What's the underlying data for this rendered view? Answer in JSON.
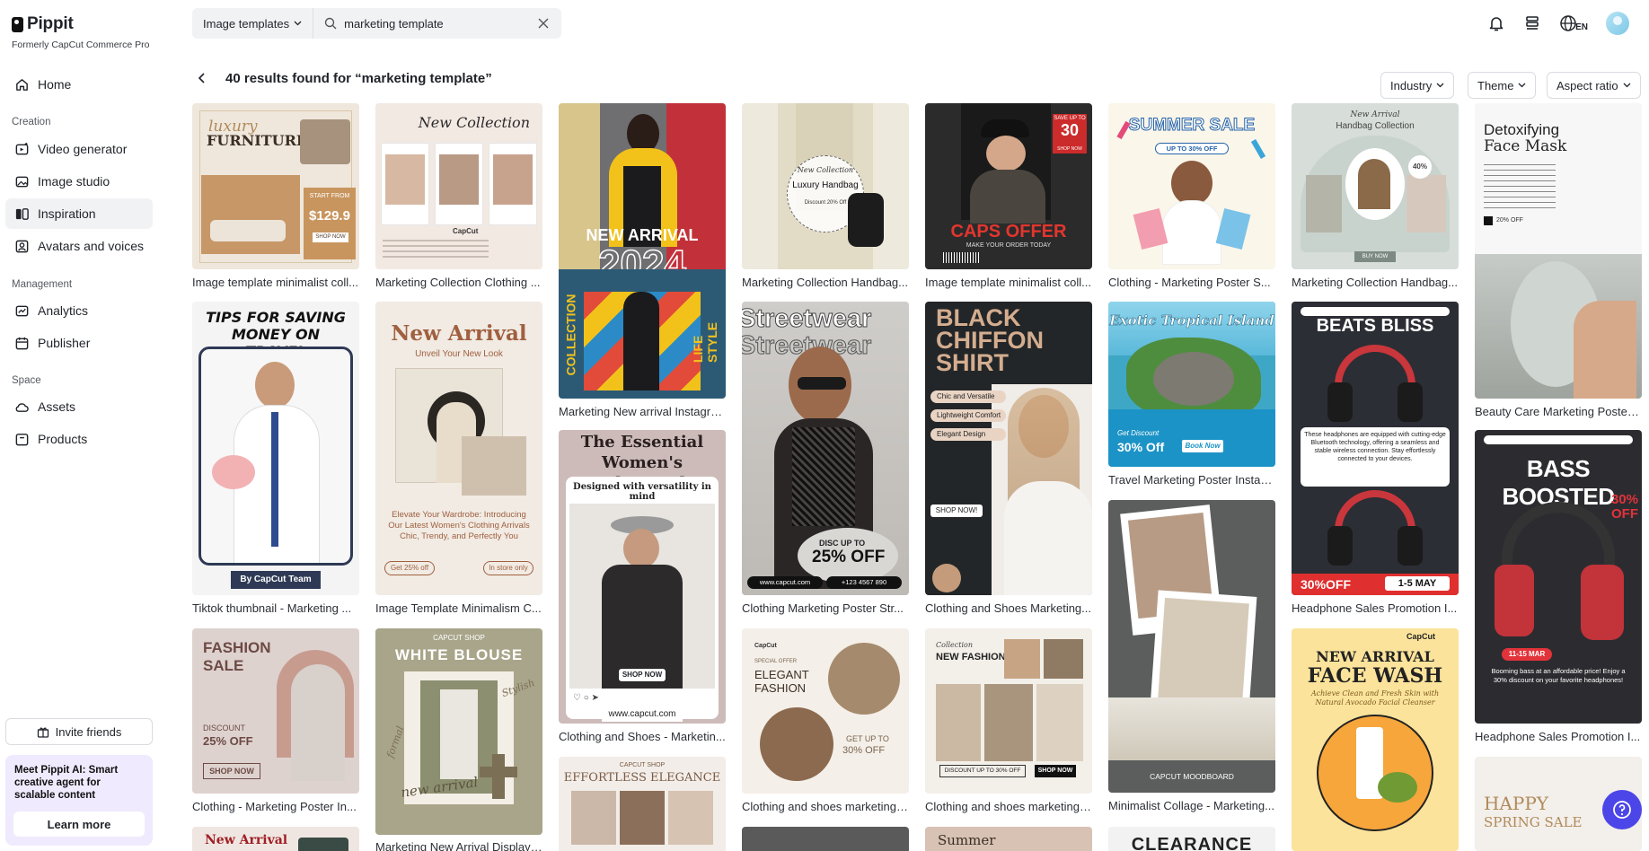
{
  "brand": {
    "name": "Pippit",
    "subtitle": "Formerly CapCut Commerce Pro"
  },
  "nav": {
    "home": "Home",
    "creation_label": "Creation",
    "video_generator": "Video generator",
    "image_studio": "Image studio",
    "inspiration": "Inspiration",
    "avatars": "Avatars and voices",
    "management_label": "Management",
    "analytics": "Analytics",
    "publisher": "Publisher",
    "space_label": "Space",
    "assets": "Assets",
    "products": "Products"
  },
  "invite": {
    "label": "Invite friends"
  },
  "promo": {
    "text": "Meet Pippit AI: Smart creative agent for scalable content",
    "button": "Learn more"
  },
  "search": {
    "type": "Image templates",
    "value": "marketing template"
  },
  "header": {
    "lang": "EN"
  },
  "results": {
    "title": "40 results found for “marketing template”"
  },
  "filters": {
    "industry": "Industry",
    "theme": "Theme",
    "aspect": "Aspect ratio"
  },
  "cards": {
    "c1": {
      "caption": "Image template minimalist coll...",
      "t1": "luxury",
      "t2": "FURNITURE",
      "t3": "START FROM",
      "t4": "$129.9",
      "t5": "SHOP NOW"
    },
    "c2": {
      "caption": "Marketing Collection Clothing ...",
      "t1": "New Collection",
      "t2": "CapCut"
    },
    "c3": {
      "caption": "Marketing New arrival Instagra...",
      "t1": "NEW ARRIVAL",
      "t2": "2024",
      "t3": "COLLECTION",
      "t4": "LIFE STYLE"
    },
    "c4": {
      "caption": "Marketing Collection Handbag...",
      "t1": "New Collection",
      "t2": "Luxury Handbag",
      "t3": "Discount 20% Off"
    },
    "c5": {
      "caption": "Image template minimalist coll...",
      "t1": "CAPS OFFER",
      "t2": "MAKE YOUR ORDER TODAY",
      "t3": "SAVE UP TO",
      "t4": "30",
      "t5": "SHOP NOW"
    },
    "c6": {
      "caption": "Clothing - Marketing Poster S...",
      "t1": "SUMMER SALE",
      "t2": "UP TO 30% OFF"
    },
    "c7": {
      "caption": "Marketing Collection Handbag...",
      "t1": "New Arrival",
      "t2": "Handbag Collection",
      "t3": "40%",
      "t4": "BUY NOW"
    },
    "c8": {
      "caption": "Beauty Care Marketing Poster ...",
      "t1": "Detoxifying",
      "t2": "Face Mask",
      "t3": "20% OFF"
    },
    "c9": {
      "caption": "Tiktok thumbnail - Marketing ...",
      "t1": "TIPS FOR SAVING MONEY ON TRAVEL",
      "t2": "By CapCut Team"
    },
    "c10": {
      "caption": "Image Template Minimalism C...",
      "t1": "New Arrival",
      "t2": "Unveil Your New Look",
      "t3": "Elevate Your Wardrobe: Introducing Our Latest Women's Clothing Arrivals Chic, Trendy, and Perfectly You",
      "t4": "Get 25% off",
      "t5": "In store only"
    },
    "c11": {
      "caption": "Clothing and Shoes - Marketin...",
      "t1": "The Essential Women's Leather Jacket",
      "t2": "Designed with versatility in mind",
      "t3": "SHOP NOW",
      "t4": "www.capcut.com"
    },
    "c12": {
      "caption": "Clothing Marketing Poster Str...",
      "t1": "Streetwear",
      "t2": "DISC UP TO",
      "t3": "25% OFF",
      "t4": "www.capcut.com",
      "t5": "+123 4567 890"
    },
    "c13": {
      "caption": "Clothing and Shoes Marketing...",
      "t1": "BLACK CHIFFON SHIRT",
      "t2": "Chic and Versatile",
      "t3": "Lightweight Comfort",
      "t4": "Elegant Design",
      "t5": "SHOP NOW!"
    },
    "c14": {
      "caption": "Travel Marketing Poster Instag...",
      "t1": "Exotic Tropical Island",
      "t2": "Get Discount",
      "t3": "30% Off",
      "t4": "Book Now"
    },
    "c15": {
      "caption": "Headphone Sales Promotion I...",
      "t1": "BEATS BLISS",
      "t2": "30%OFF",
      "t3": "1-5 MAY",
      "t4": "These headphones are equipped with cutting-edge Bluetooth technology, offering a seamless and stable wireless connection. Stay effortlessly connected to your devices."
    },
    "c16": {
      "caption": "Headphone Sales Promotion I...",
      "t1": "BASS BOOSTED",
      "t2": "30% OFF",
      "t3": "11-15 MAR",
      "t4": "Booming bass at an affordable price! Enjoy a 30% discount on your favorite headphones!"
    },
    "c17": {
      "caption": "Clothing - Marketing Poster In...",
      "t1": "FASHION SALE",
      "t2": "DISCOUNT",
      "t3": "25% OFF",
      "t4": "SHOP NOW"
    },
    "c18": {
      "caption": "Marketing New Arrival Display ...",
      "t1": "CAPCUT SHOP",
      "t2": "WHITE BLOUSE",
      "t3": "new arrival",
      "t4": "Stylish",
      "t5": "formal"
    },
    "c19": {
      "caption": "Clothing and shoes marketing ...",
      "t1": "ELEGANT FASHION",
      "t2": "SPECIAL OFFER",
      "t3": "GET UP TO",
      "t4": "30% OFF",
      "t5": "CapCut"
    },
    "c20": {
      "caption": "Clothing and shoes marketing ...",
      "t1": "NEW FASHION",
      "t2": "DISCOUNT UP TO 30% OFF",
      "t3": "SHOP NOW",
      "t4": "Collection"
    },
    "c21": {
      "caption": "Minimalist Collage - Marketing...",
      "t1": "CAPCUT MOODBOARD"
    },
    "c22": {
      "caption": "",
      "t1": "NEW ARRIVAL",
      "t2": "FACE WASH",
      "t3": "Achieve Clean and Fresh Skin with Natural Avocado Facial Cleanser",
      "t4": "CapCut"
    },
    "c23": {
      "t1": "CAPCUT SHOP",
      "t2": "EFFORTLESS ELEGANCE"
    },
    "c24": {
      "t1": "New Arrival"
    },
    "c25": {
      "t1": "Summer"
    },
    "c26": {
      "t1": "CLEARANCE"
    },
    "c27": {
      "t1": "HAPPY",
      "t2": "SPRING SALE"
    }
  },
  "colors": {
    "accent": "#4c46e8",
    "active_nav": "#f1f2f4",
    "promo_bg": "#f0eafe"
  }
}
